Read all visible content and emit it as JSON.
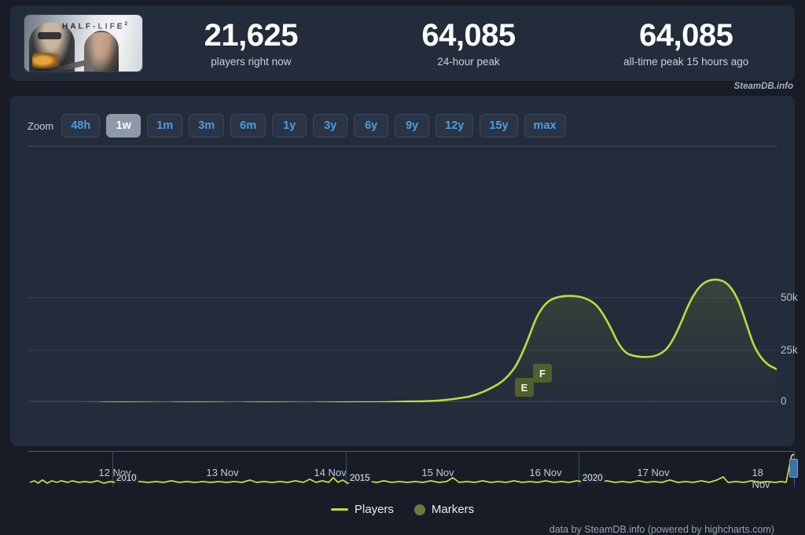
{
  "header": {
    "game_title": "HALF-LIFE",
    "game_title_sup": "2",
    "stats": [
      {
        "value": "21,625",
        "label": "players right now"
      },
      {
        "value": "64,085",
        "label": "24-hour peak"
      },
      {
        "value": "64,085",
        "label": "all-time peak 15 hours ago"
      }
    ],
    "attribution": "SteamDB.info"
  },
  "chart_panel": {
    "zoom_label": "Zoom",
    "ranges": [
      {
        "label": "48h",
        "active": false
      },
      {
        "label": "1w",
        "active": true
      },
      {
        "label": "1m",
        "active": false
      },
      {
        "label": "3m",
        "active": false
      },
      {
        "label": "6m",
        "active": false
      },
      {
        "label": "1y",
        "active": false
      },
      {
        "label": "3y",
        "active": false
      },
      {
        "label": "6y",
        "active": false
      },
      {
        "label": "9y",
        "active": false
      },
      {
        "label": "12y",
        "active": false
      },
      {
        "label": "15y",
        "active": false
      },
      {
        "label": "max",
        "active": false
      }
    ],
    "legend": [
      {
        "label": "Players",
        "marker": "line",
        "color": "#bcdc3c"
      },
      {
        "label": "Markers",
        "marker": "dot",
        "color": "#6d7a3c"
      }
    ],
    "footer": "data by SteamDB.info (powered by highcharts.com)"
  },
  "navigator": {
    "year_labels": [
      "2010",
      "2015",
      "2020"
    ],
    "handle_position": "right"
  },
  "chart_data": {
    "type": "line",
    "title": "",
    "xlabel": "",
    "ylabel": "",
    "ylim": [
      0,
      62000
    ],
    "ytick_labels": [
      "50k",
      "25k",
      "0"
    ],
    "ytick_values": [
      50000,
      25000,
      0
    ],
    "grid": true,
    "legend_position": "bottom-center",
    "x_tick_labels": [
      "12 Nov",
      "13 Nov",
      "14 Nov",
      "15 Nov",
      "16 Nov",
      "17 Nov",
      "18 Nov"
    ],
    "line_color": "#bcdc3c",
    "series": [
      {
        "name": "Players",
        "x": [
          "12 Nov 00:00",
          "12 Nov 06:00",
          "12 Nov 12:00",
          "12 Nov 18:00",
          "13 Nov 00:00",
          "13 Nov 06:00",
          "13 Nov 12:00",
          "13 Nov 18:00",
          "14 Nov 00:00",
          "14 Nov 06:00",
          "14 Nov 12:00",
          "14 Nov 18:00",
          "15 Nov 00:00",
          "15 Nov 06:00",
          "15 Nov 12:00",
          "15 Nov 18:00",
          "15 Nov 21:00",
          "16 Nov 00:00",
          "16 Nov 03:00",
          "16 Nov 06:00",
          "16 Nov 09:00",
          "16 Nov 12:00",
          "16 Nov 15:00",
          "16 Nov 18:00",
          "16 Nov 21:00",
          "17 Nov 00:00",
          "17 Nov 03:00",
          "17 Nov 06:00",
          "17 Nov 09:00",
          "17 Nov 12:00",
          "17 Nov 15:00",
          "17 Nov 18:00",
          "17 Nov 21:00",
          "18 Nov 00:00",
          "18 Nov 03:00",
          "18 Nov 06:00",
          "18 Nov 09:00",
          "18 Nov 12:00"
        ],
        "values": [
          1200,
          1100,
          1500,
          1400,
          1300,
          1200,
          1600,
          1500,
          1400,
          1300,
          1700,
          1600,
          1500,
          1400,
          1800,
          1900,
          2000,
          3000,
          6500,
          9000,
          22000,
          38000,
          48000,
          51500,
          51000,
          38000,
          28500,
          26500,
          26500,
          33000,
          47000,
          57000,
          60500,
          61000,
          54000,
          38000,
          27500,
          22500
        ],
        "peak": 64085,
        "current": 21625
      }
    ],
    "annotations": [
      {
        "label": "E",
        "x": "16 Nov 00:00",
        "type": "marker"
      },
      {
        "label": "F",
        "x": "16 Nov 05:00",
        "type": "marker"
      }
    ],
    "navigator_series": {
      "name": "Players (full history)",
      "x_range": [
        "2008",
        "2023"
      ],
      "note": "long flat low-value history with a sharp spike at the right edge"
    }
  }
}
